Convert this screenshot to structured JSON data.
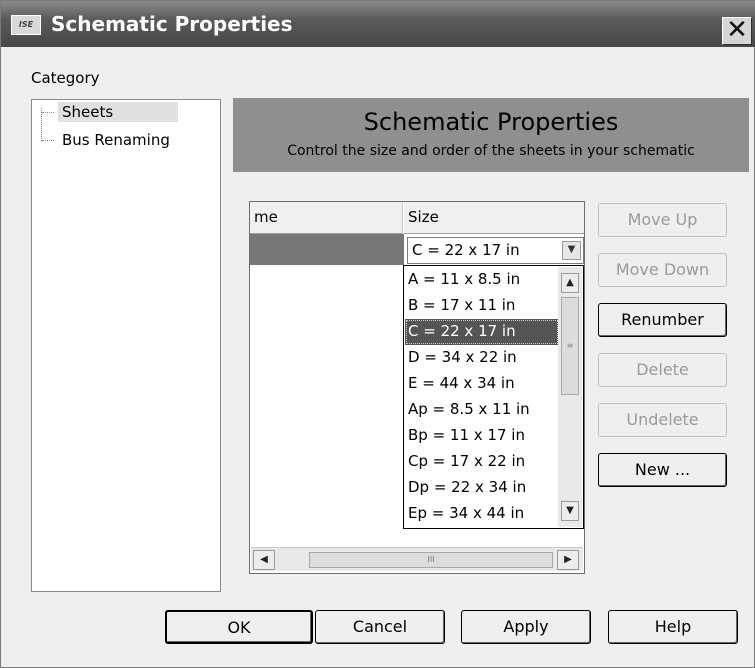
{
  "window": {
    "title": "Schematic Properties",
    "app_icon_text": "ISE",
    "close_glyph": "✕"
  },
  "category": {
    "label": "Category",
    "items": [
      {
        "label": "Sheets",
        "selected": true
      },
      {
        "label": "Bus Renaming",
        "selected": false
      }
    ]
  },
  "header": {
    "title": "Schematic Properties",
    "subtitle": "Control the size and order of the sheets in your schematic"
  },
  "grid": {
    "columns": [
      "me",
      "Size"
    ],
    "row": {
      "name": "",
      "size": "C = 22 x 17 in"
    },
    "combo_arrow": "▼",
    "scroll_left": "◀",
    "scroll_right": "▶",
    "thumb_grip": "III"
  },
  "dropdown": {
    "options": [
      "A = 11 x 8.5 in",
      "B = 17 x 11 in",
      "C = 22 x 17 in",
      "D = 34 x 22 in",
      "E = 44 x 34 in",
      "Ap = 8.5 x 11 in",
      "Bp = 11 x 17 in",
      "Cp = 17 x 22 in",
      "Dp = 22 x 34 in",
      "Ep = 34 x 44 in"
    ],
    "selected_index": 2,
    "scroll_up": "▲",
    "scroll_down": "▼",
    "thumb_grip": "≡"
  },
  "side_buttons": {
    "move_up": "Move Up",
    "move_down": "Move Down",
    "renumber": "Renumber",
    "delete": "Delete",
    "undelete": "Undelete",
    "new": "New ..."
  },
  "bottom_buttons": {
    "ok": "OK",
    "cancel": "Cancel",
    "apply": "Apply",
    "help": "Help"
  }
}
